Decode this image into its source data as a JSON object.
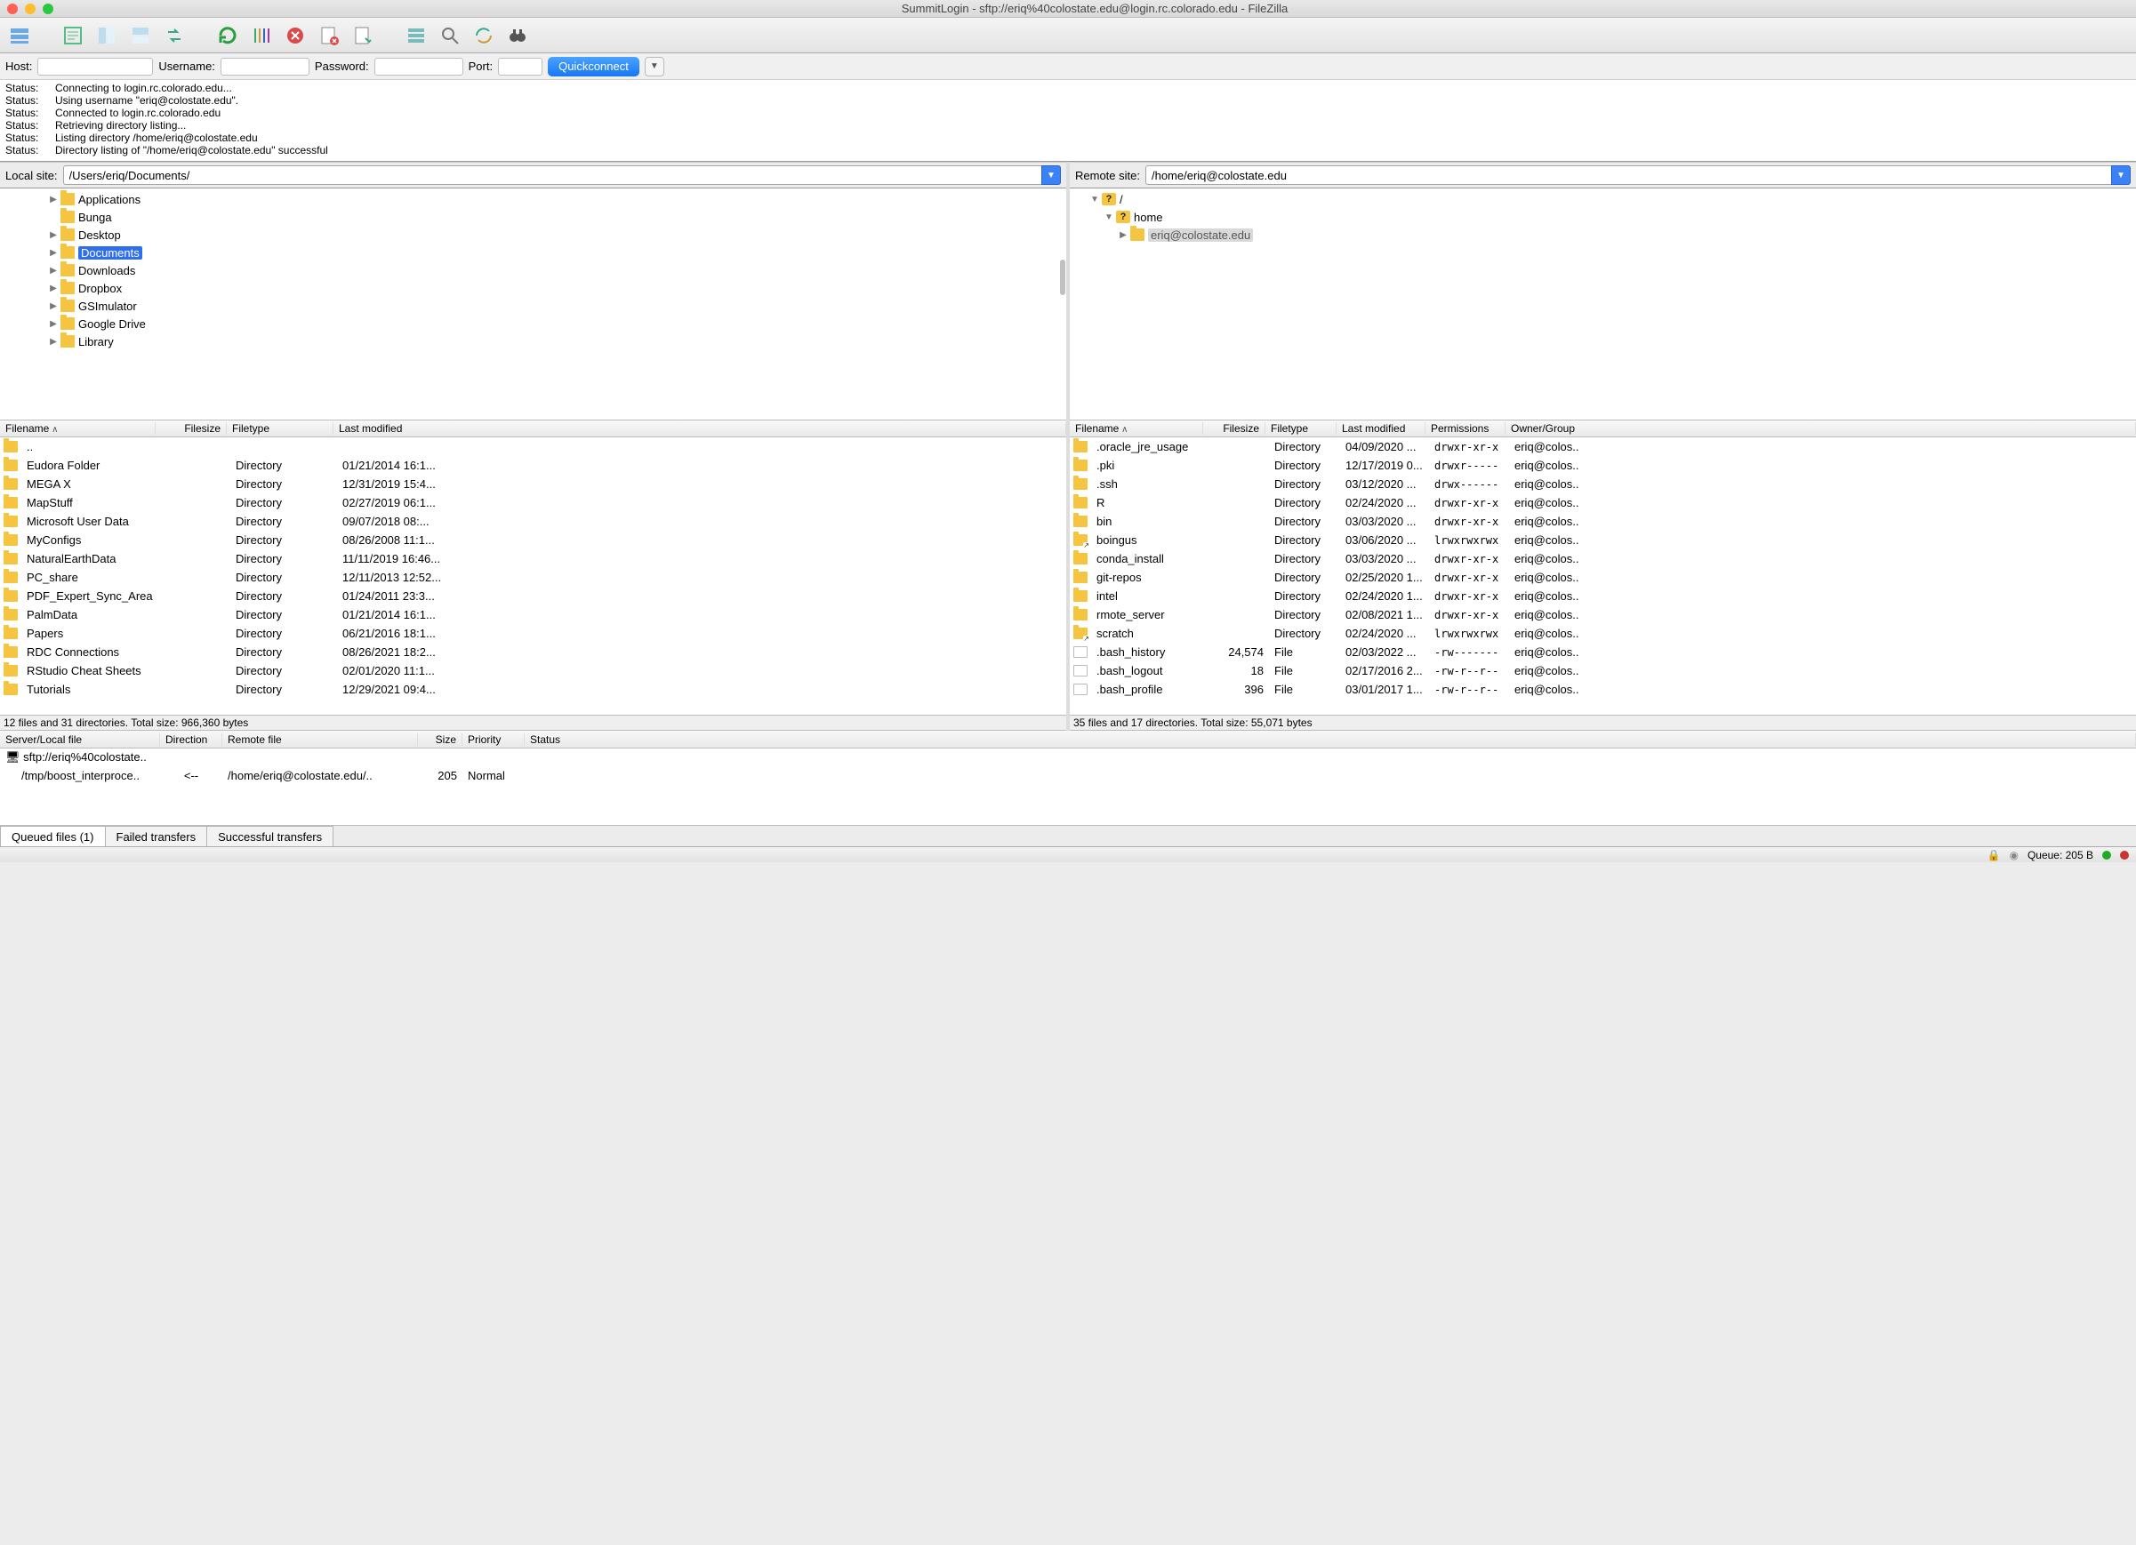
{
  "window": {
    "title": "SummitLogin - sftp://eriq%40colostate.edu@login.rc.colorado.edu - FileZilla"
  },
  "quickconnect": {
    "host_label": "Host:",
    "user_label": "Username:",
    "pass_label": "Password:",
    "port_label": "Port:",
    "button": "Quickconnect",
    "host": "",
    "user": "",
    "pass": "",
    "port": ""
  },
  "log": [
    {
      "label": "Status:",
      "msg": "Connecting to login.rc.colorado.edu..."
    },
    {
      "label": "Status:",
      "msg": "Using username \"eriq@colostate.edu\"."
    },
    {
      "label": "Status:",
      "msg": "Connected to login.rc.colorado.edu"
    },
    {
      "label": "Status:",
      "msg": "Retrieving directory listing..."
    },
    {
      "label": "Status:",
      "msg": "Listing directory /home/eriq@colostate.edu"
    },
    {
      "label": "Status:",
      "msg": "Directory listing of \"/home/eriq@colostate.edu\" successful"
    }
  ],
  "local": {
    "label": "Local site:",
    "path": "/Users/eriq/Documents/",
    "tree": [
      {
        "indent": 2,
        "tw": "▶",
        "name": "Applications"
      },
      {
        "indent": 2,
        "tw": "",
        "name": "Bunga"
      },
      {
        "indent": 2,
        "tw": "▶",
        "name": "Desktop"
      },
      {
        "indent": 2,
        "tw": "▶",
        "name": "Documents",
        "selected": true
      },
      {
        "indent": 2,
        "tw": "▶",
        "name": "Downloads"
      },
      {
        "indent": 2,
        "tw": "▶",
        "name": "Dropbox"
      },
      {
        "indent": 2,
        "tw": "▶",
        "name": "GSImulator"
      },
      {
        "indent": 2,
        "tw": "▶",
        "name": "Google Drive"
      },
      {
        "indent": 2,
        "tw": "▶",
        "name": "Library"
      }
    ],
    "cols": {
      "filename": "Filename",
      "filesize": "Filesize",
      "filetype": "Filetype",
      "modified": "Last modified"
    },
    "files": [
      {
        "name": "..",
        "type": "",
        "mod": ""
      },
      {
        "name": "Eudora Folder",
        "type": "Directory",
        "mod": "01/21/2014 16:1..."
      },
      {
        "name": "MEGA X",
        "type": "Directory",
        "mod": "12/31/2019 15:4..."
      },
      {
        "name": "MapStuff",
        "type": "Directory",
        "mod": "02/27/2019 06:1..."
      },
      {
        "name": "Microsoft User Data",
        "type": "Directory",
        "mod": "09/07/2018 08:..."
      },
      {
        "name": "MyConfigs",
        "type": "Directory",
        "mod": "08/26/2008 11:1..."
      },
      {
        "name": "NaturalEarthData",
        "type": "Directory",
        "mod": "11/11/2019 16:46..."
      },
      {
        "name": "PC_share",
        "type": "Directory",
        "mod": "12/11/2013 12:52..."
      },
      {
        "name": "PDF_Expert_Sync_Area",
        "type": "Directory",
        "mod": "01/24/2011 23:3..."
      },
      {
        "name": "PalmData",
        "type": "Directory",
        "mod": "01/21/2014 16:1..."
      },
      {
        "name": "Papers",
        "type": "Directory",
        "mod": "06/21/2016 18:1..."
      },
      {
        "name": "RDC Connections",
        "type": "Directory",
        "mod": "08/26/2021 18:2..."
      },
      {
        "name": "RStudio Cheat Sheets",
        "type": "Directory",
        "mod": "02/01/2020 11:1..."
      },
      {
        "name": "Tutorials",
        "type": "Directory",
        "mod": "12/29/2021 09:4..."
      }
    ],
    "status": "12 files and 31 directories. Total size: 966,360 bytes"
  },
  "remote": {
    "label": "Remote site:",
    "path": "/home/eriq@colostate.edu",
    "tree": [
      {
        "indent": 0,
        "tw": "▼",
        "name": "/",
        "q": true
      },
      {
        "indent": 1,
        "tw": "▼",
        "name": "home",
        "q": true
      },
      {
        "indent": 2,
        "tw": "▶",
        "name": "eriq@colostate.edu",
        "hsel": true
      }
    ],
    "cols": {
      "filename": "Filename",
      "filesize": "Filesize",
      "filetype": "Filetype",
      "modified": "Last modified",
      "perms": "Permissions",
      "owner": "Owner/Group"
    },
    "files": [
      {
        "name": ".oracle_jre_usage",
        "size": "",
        "type": "Directory",
        "mod": "04/09/2020 ...",
        "perm": "drwxr-xr-x",
        "own": "eriq@colos..",
        "icon": "dir"
      },
      {
        "name": ".pki",
        "size": "",
        "type": "Directory",
        "mod": "12/17/2019 0...",
        "perm": "drwxr-----",
        "own": "eriq@colos..",
        "icon": "dir"
      },
      {
        "name": ".ssh",
        "size": "",
        "type": "Directory",
        "mod": "03/12/2020 ...",
        "perm": "drwx------",
        "own": "eriq@colos..",
        "icon": "dir"
      },
      {
        "name": "R",
        "size": "",
        "type": "Directory",
        "mod": "02/24/2020 ...",
        "perm": "drwxr-xr-x",
        "own": "eriq@colos..",
        "icon": "dir"
      },
      {
        "name": "bin",
        "size": "",
        "type": "Directory",
        "mod": "03/03/2020 ...",
        "perm": "drwxr-xr-x",
        "own": "eriq@colos..",
        "icon": "dir"
      },
      {
        "name": "boingus",
        "size": "",
        "type": "Directory",
        "mod": "03/06/2020 ...",
        "perm": "lrwxrwxrwx",
        "own": "eriq@colos..",
        "icon": "link"
      },
      {
        "name": "conda_install",
        "size": "",
        "type": "Directory",
        "mod": "03/03/2020 ...",
        "perm": "drwxr-xr-x",
        "own": "eriq@colos..",
        "icon": "dir"
      },
      {
        "name": "git-repos",
        "size": "",
        "type": "Directory",
        "mod": "02/25/2020 1...",
        "perm": "drwxr-xr-x",
        "own": "eriq@colos..",
        "icon": "dir"
      },
      {
        "name": "intel",
        "size": "",
        "type": "Directory",
        "mod": "02/24/2020 1...",
        "perm": "drwxr-xr-x",
        "own": "eriq@colos..",
        "icon": "dir"
      },
      {
        "name": "rmote_server",
        "size": "",
        "type": "Directory",
        "mod": "02/08/2021 1...",
        "perm": "drwxr-xr-x",
        "own": "eriq@colos..",
        "icon": "dir"
      },
      {
        "name": "scratch",
        "size": "",
        "type": "Directory",
        "mod": "02/24/2020 ...",
        "perm": "lrwxrwxrwx",
        "own": "eriq@colos..",
        "icon": "link"
      },
      {
        "name": ".bash_history",
        "size": "24,574",
        "type": "File",
        "mod": "02/03/2022 ...",
        "perm": "-rw-------",
        "own": "eriq@colos..",
        "icon": "file"
      },
      {
        "name": ".bash_logout",
        "size": "18",
        "type": "File",
        "mod": "02/17/2016 2...",
        "perm": "-rw-r--r--",
        "own": "eriq@colos..",
        "icon": "file"
      },
      {
        "name": ".bash_profile",
        "size": "396",
        "type": "File",
        "mod": "03/01/2017 1...",
        "perm": "-rw-r--r--",
        "own": "eriq@colos..",
        "icon": "file"
      }
    ],
    "status": "35 files and 17 directories. Total size: 55,071 bytes"
  },
  "queue": {
    "cols": {
      "server": "Server/Local file",
      "dir": "Direction",
      "remote": "Remote file",
      "size": "Size",
      "prio": "Priority",
      "status": "Status"
    },
    "server_row": "sftp://eriq%40colostate..",
    "items": [
      {
        "local": "/tmp/boost_interproce..",
        "dir": "<--",
        "remote": "/home/eriq@colostate.edu/..",
        "size": "205",
        "prio": "Normal",
        "status": ""
      }
    ]
  },
  "tabs": {
    "queued": "Queued files (1)",
    "failed": "Failed transfers",
    "success": "Successful transfers"
  },
  "statusbar": {
    "queue": "Queue: 205 B"
  }
}
